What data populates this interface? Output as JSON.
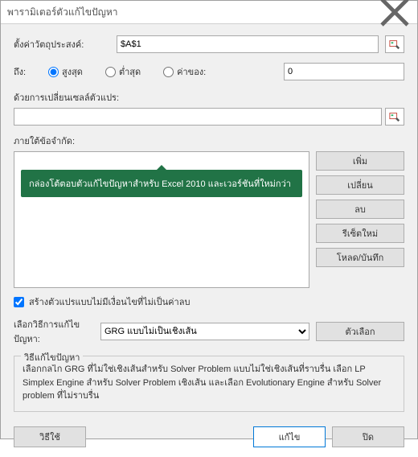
{
  "title": "พารามิเตอร์ตัวแก้ไขปัญหา",
  "objective": {
    "label": "ตั้งค่าวัตถุประสงค์:",
    "value": "$A$1"
  },
  "to": {
    "label": "ถึง:",
    "max": "สูงสุด",
    "min": "ต่ำสุด",
    "valueOf": "ค่าของ:",
    "valueField": "0"
  },
  "byChanging": {
    "label": "ด้วยการเปลี่ยนเซลล์ตัวแปร:",
    "value": ""
  },
  "constraints": {
    "label": "ภายใต้ข้อจำกัด:",
    "tooltip": "กล่องโต้ตอบตัวแก้ไขปัญหาสำหรับ Excel 2010 และเวอร์ชันที่ใหม่กว่า"
  },
  "buttons": {
    "add": "เพิ่ม",
    "change": "เปลี่ยน",
    "delete": "ลบ",
    "reset": "รีเซ็ตใหม่",
    "loadSave": "โหลด/บันทึก",
    "options": "ตัวเลือก",
    "help": "วิธีใช้",
    "solve": "แก้ไข",
    "close": "ปิด"
  },
  "nonneg": {
    "label": "สร้างตัวแปรแบบไม่มีเงื่อนไขที่ไม่เป็นค่าลบ"
  },
  "method": {
    "label": "เลือกวิธีการแก้ไขปัญหา:",
    "selected": "GRG แบบไม่เป็นเชิงเส้น"
  },
  "group": {
    "title": "วิธีแก้ไขปัญหา",
    "text": "เลือกกลไก GRG ที่ไม่ใช่เชิงเส้นสำหรับ Solver Problem แบบไม่ใช่เชิงเส้นที่ราบรื่น เลือก LP Simplex Engine สำหรับ Solver Problem เชิงเส้น และเลือก Evolutionary Engine สำหรับ Solver problem ที่ไม่ราบรื่น"
  }
}
